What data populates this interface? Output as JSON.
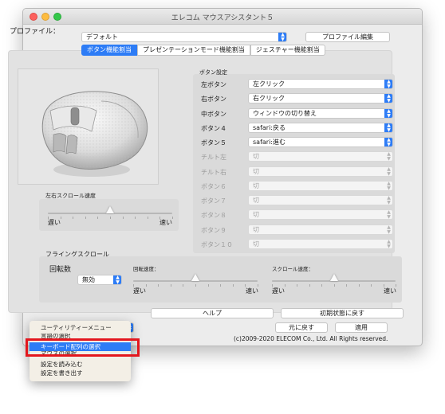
{
  "window": {
    "title": "エレコム マウスアシスタント５"
  },
  "profile": {
    "label": "プロファイル：",
    "value": "デフォルト",
    "edit_button": "プロファイル編集"
  },
  "tabs": [
    {
      "label": "ボタン機能割当"
    },
    {
      "label": "プレゼンテーションモード機能割当"
    },
    {
      "label": "ジェスチャー機能割当"
    }
  ],
  "horizontal_scroll": {
    "label": "左右スクロール速度",
    "slow": "遅い",
    "fast": "速い",
    "level": 0.5
  },
  "button_settings": {
    "header": "ボタン設定",
    "rows": [
      {
        "label": "左ボタン",
        "value": "左クリック",
        "enabled": true
      },
      {
        "label": "右ボタン",
        "value": "右クリック",
        "enabled": true
      },
      {
        "label": "中ボタン",
        "value": "ウィンドウの切り替え",
        "enabled": true
      },
      {
        "label": "ボタン４",
        "value": "safari:戻る",
        "enabled": true
      },
      {
        "label": "ボタン５",
        "value": "safari:進む",
        "enabled": true
      },
      {
        "label": "チルト左",
        "value": "切",
        "enabled": false
      },
      {
        "label": "チルト右",
        "value": "切",
        "enabled": false
      },
      {
        "label": "ボタン６",
        "value": "切",
        "enabled": false
      },
      {
        "label": "ボタン７",
        "value": "切",
        "enabled": false
      },
      {
        "label": "ボタン８",
        "value": "切",
        "enabled": false
      },
      {
        "label": "ボタン９",
        "value": "切",
        "enabled": false
      },
      {
        "label": "ボタン１０",
        "value": "切",
        "enabled": false
      }
    ]
  },
  "flying_scroll": {
    "label": "フライングスクロール",
    "rotation_label": "回転数",
    "rotation_value": "無効",
    "rotation_speed": {
      "label": "回転速度：",
      "slow": "遅い",
      "fast": "速い",
      "level": 0.5
    },
    "scroll_speed": {
      "label": "スクロール速度：",
      "slow": "遅い",
      "fast": "速い",
      "level": 0.5
    }
  },
  "actions": {
    "help": "ヘルプ",
    "reset": "初期状態に戻す",
    "undo": "元に戻す",
    "apply": "適用"
  },
  "copyright": "(c)2009-2020 ELECOM Co., Ltd. All Rights reserved.",
  "utility_menu": {
    "items": [
      {
        "label": "ユーティリティーメニュー",
        "state": "normal"
      },
      {
        "label": "言語の選択",
        "state": "cut"
      },
      {
        "label": "キーボード配列の選択",
        "state": "highlighted"
      },
      {
        "label": "マウスの選択",
        "state": "cut"
      },
      {
        "label": "設定を読み込む",
        "state": "normal"
      },
      {
        "label": "設定を書き出す",
        "state": "normal"
      }
    ]
  },
  "colors": {
    "accent": "#2d7cf6",
    "annotation": "#e3171e"
  }
}
